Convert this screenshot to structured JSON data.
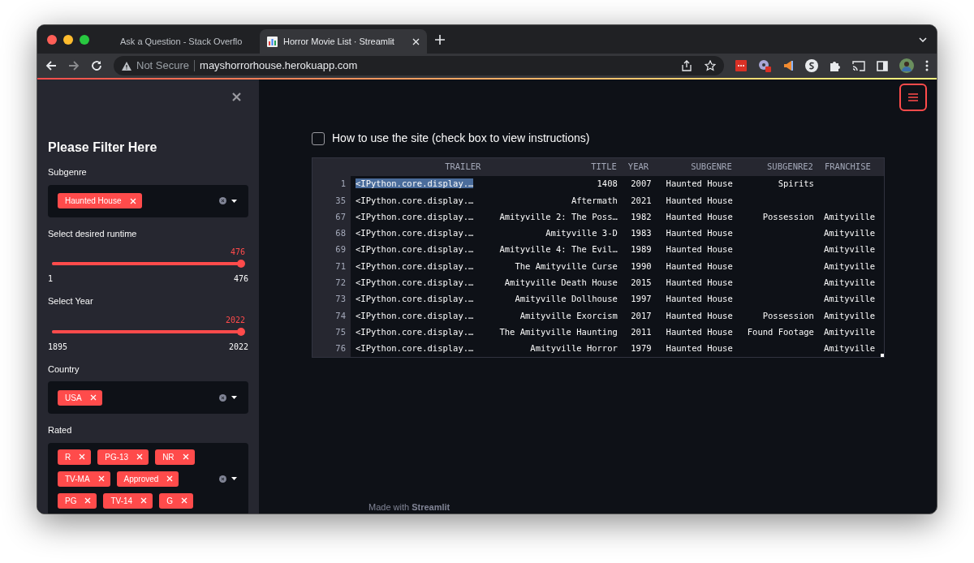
{
  "browser": {
    "tabs": [
      {
        "title": "Ask a Question - Stack Overflo",
        "selected": false,
        "kind": "stack"
      },
      {
        "title": "Horror Movie List · Streamlit",
        "selected": true,
        "kind": "chart"
      }
    ],
    "security": "Not Secure",
    "url": "mayshorrorhouse.herokuapp.com"
  },
  "sidebar": {
    "heading": "Please Filter Here",
    "filters": [
      {
        "kind": "multiselect",
        "label": "Subgenre",
        "tags": [
          "Haunted House"
        ]
      },
      {
        "kind": "slider",
        "label": "Select desired runtime",
        "value": "476",
        "min": "1",
        "max": "476",
        "level": 1
      },
      {
        "kind": "slider",
        "label": "Select Year",
        "value": "2022",
        "min": "1895",
        "max": "2022",
        "level": 1
      },
      {
        "kind": "multiselect",
        "label": "Country",
        "tags": [
          "USA"
        ]
      },
      {
        "kind": "multiselect",
        "label": "Rated",
        "tags": [
          "R",
          "PG-13",
          "NR",
          "TV-MA",
          "Approved",
          "PG",
          "TV-14",
          "G"
        ]
      }
    ]
  },
  "main": {
    "instructions": {
      "label": "How to use the site (check box to view instructions)",
      "checked": false
    },
    "table": {
      "columns": [
        "TRAILER",
        "TITLE",
        "YEAR",
        "SUBGENRE",
        "SUBGENRE2",
        "FRANCHISE"
      ],
      "rows": [
        {
          "index": "1",
          "cells": [
            "<IPython.core.display.…",
            "1408",
            "2007",
            "Haunted House",
            "Spirits",
            ""
          ],
          "selected": true
        },
        {
          "index": "35",
          "cells": [
            "<IPython.core.display.…",
            "Aftermath",
            "2021",
            "Haunted House",
            "",
            ""
          ],
          "selected": false
        },
        {
          "index": "67",
          "cells": [
            "<IPython.core.display.…",
            "Amityville 2: The Poss…",
            "1982",
            "Haunted House",
            "Possession",
            "Amityville"
          ],
          "selected": false
        },
        {
          "index": "68",
          "cells": [
            "<IPython.core.display.…",
            "Amityville 3-D",
            "1983",
            "Haunted House",
            "",
            "Amityville"
          ],
          "selected": false
        },
        {
          "index": "69",
          "cells": [
            "<IPython.core.display.…",
            "Amityville 4: The Evil…",
            "1989",
            "Haunted House",
            "",
            "Amityville"
          ],
          "selected": false
        },
        {
          "index": "71",
          "cells": [
            "<IPython.core.display.…",
            "The Amityville Curse",
            "1990",
            "Haunted House",
            "",
            "Amityville"
          ],
          "selected": false
        },
        {
          "index": "72",
          "cells": [
            "<IPython.core.display.…",
            "Amityville Death House",
            "2015",
            "Haunted House",
            "",
            "Amityville"
          ],
          "selected": false
        },
        {
          "index": "73",
          "cells": [
            "<IPython.core.display.…",
            "Amityville Dollhouse",
            "1997",
            "Haunted House",
            "",
            "Amityville"
          ],
          "selected": false
        },
        {
          "index": "74",
          "cells": [
            "<IPython.core.display.…",
            "Amityville Exorcism",
            "2017",
            "Haunted House",
            "Possession",
            "Amityville"
          ],
          "selected": false
        },
        {
          "index": "75",
          "cells": [
            "<IPython.core.display.…",
            "The Amityville Haunting",
            "2011",
            "Haunted House",
            "Found Footage",
            "Amityville"
          ],
          "selected": false
        },
        {
          "index": "76",
          "cells": [
            "<IPython.core.display.…",
            "Amityville Horror",
            "1979",
            "Haunted House",
            "",
            "Amityville"
          ],
          "selected": false
        }
      ]
    },
    "footer": "Made with **Streamlit**"
  }
}
